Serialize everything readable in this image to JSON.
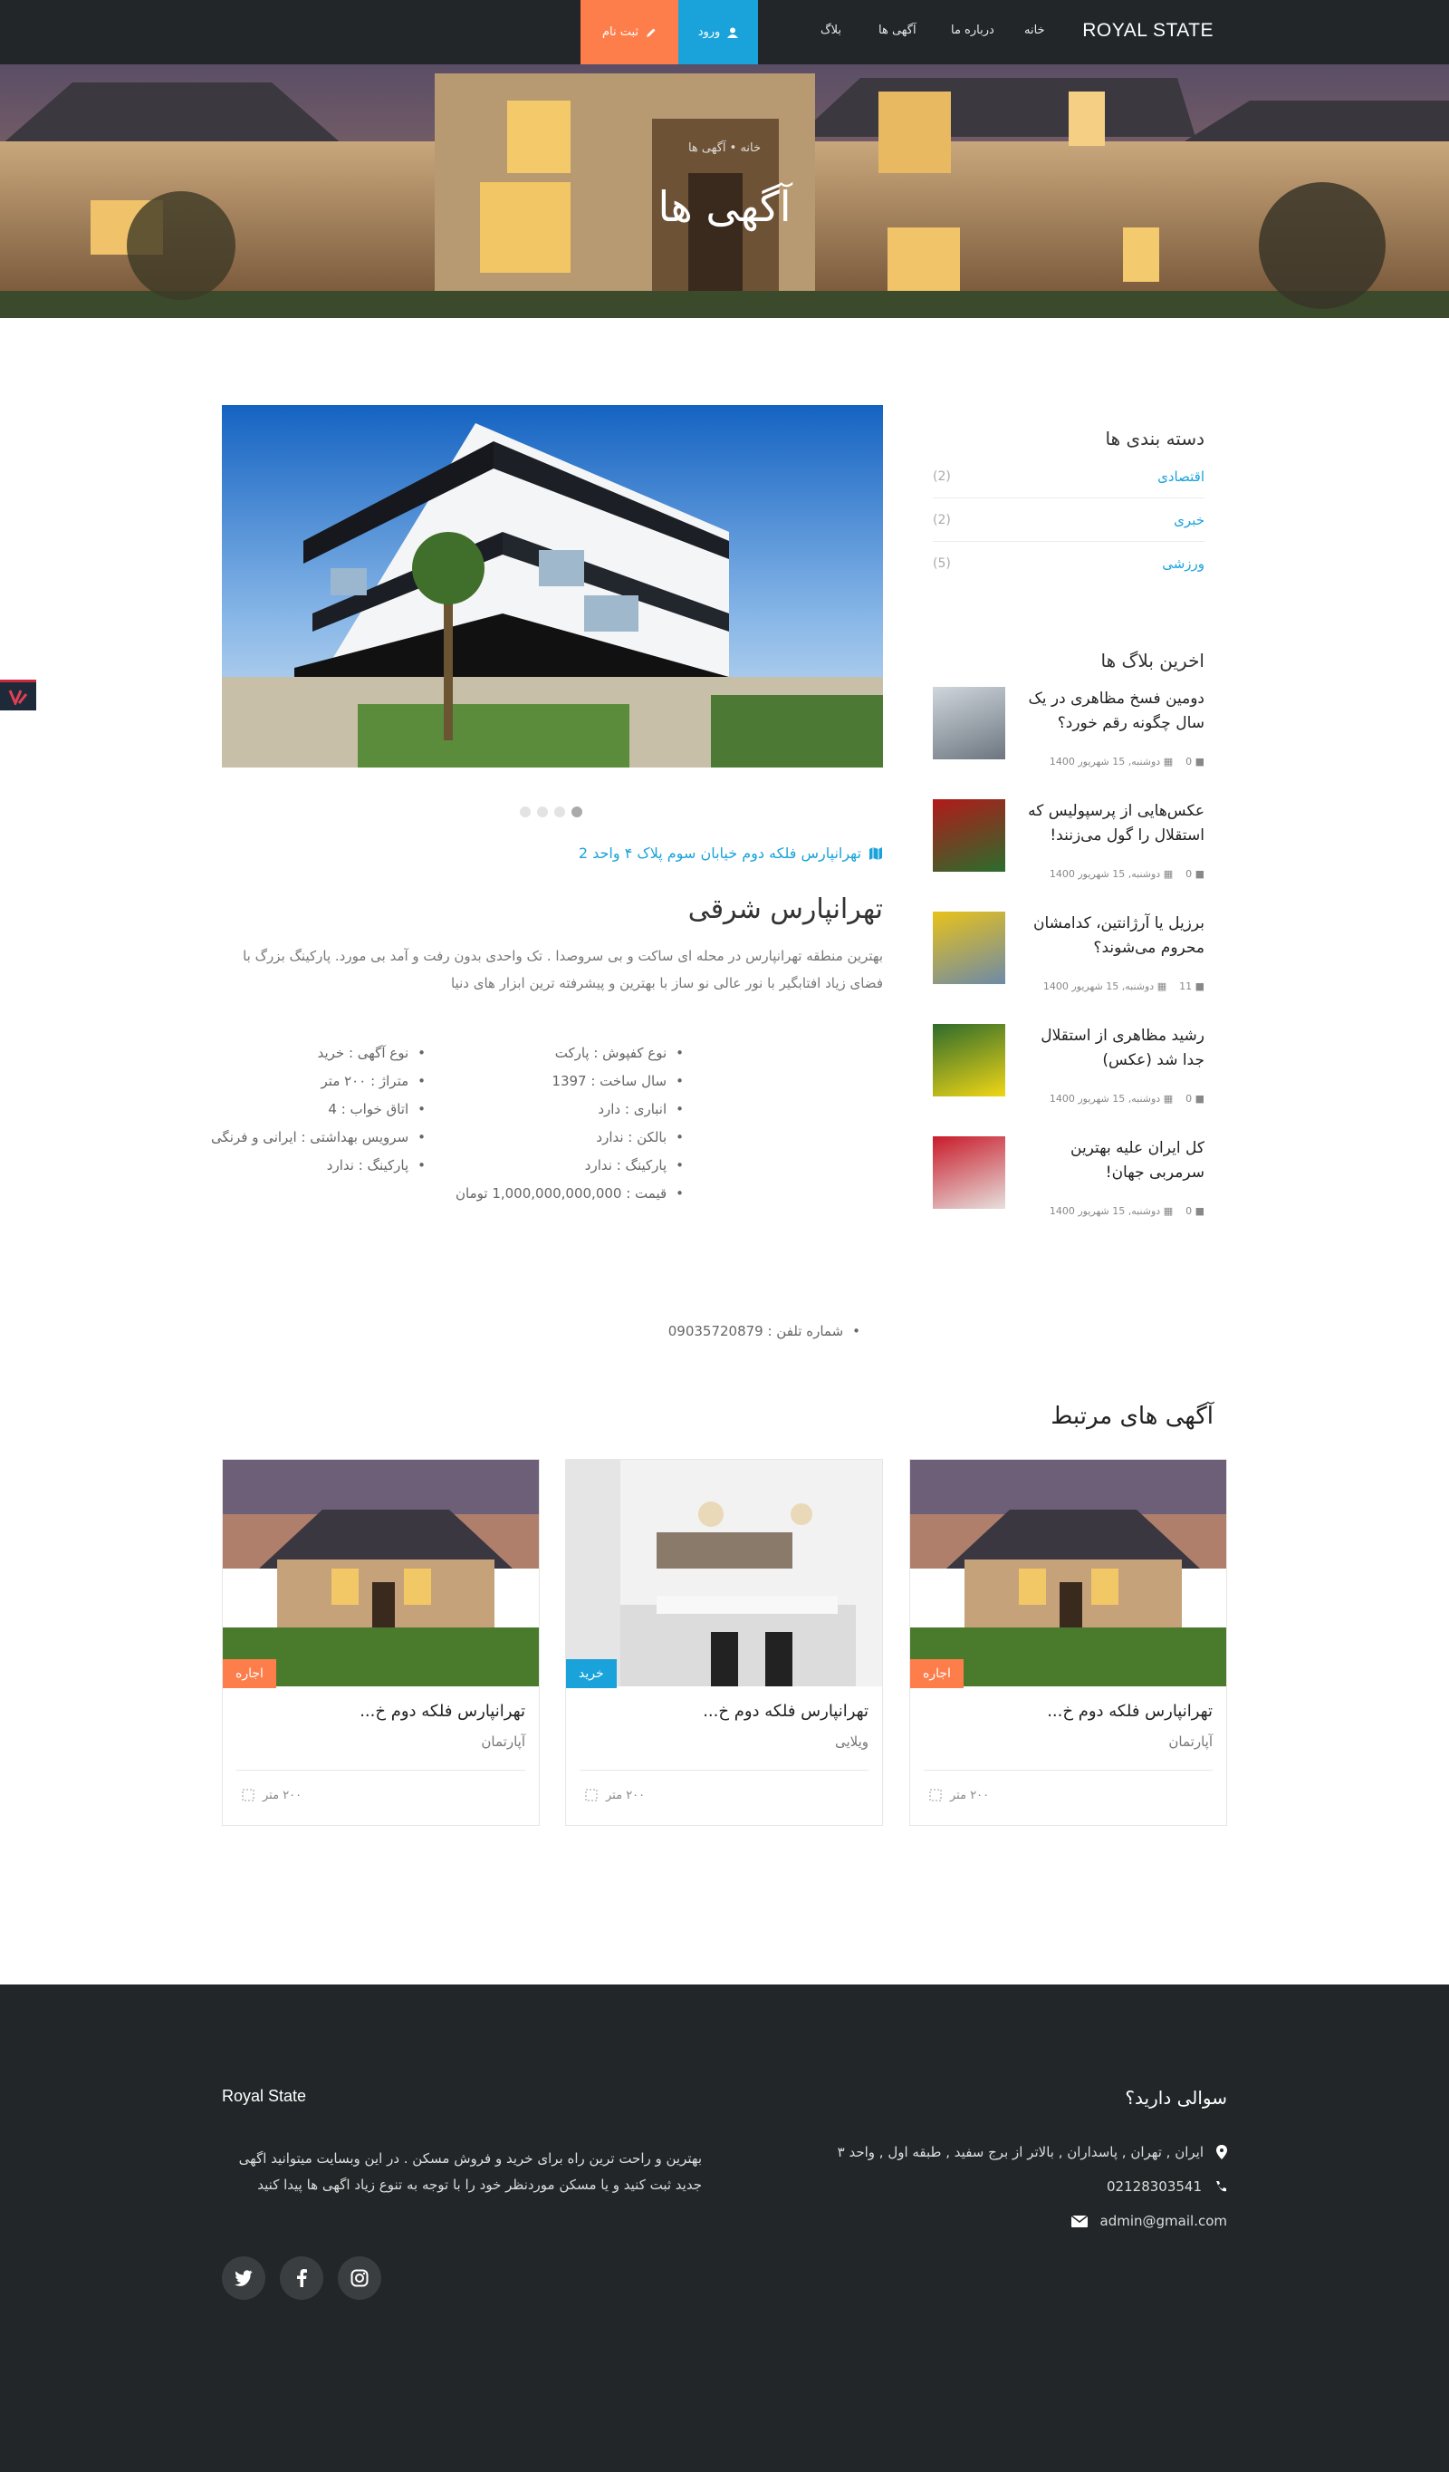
{
  "nav": {
    "brand": "ROYAL STATE",
    "links": [
      "خانه",
      "درباره ما",
      "آگهی ها",
      "بلاگ"
    ],
    "login_label": "ورود",
    "register_label": "ثبت نام"
  },
  "hero": {
    "breadcrumb": "خانه • آگهی ها",
    "title": "آگهی ها"
  },
  "property": {
    "address": "تهرانپارس فلکه دوم خیابان سوم پلاک ۴ واحد 2",
    "title": "تهرانپارس شرقی",
    "description": "بهترین منطقه تهرانپارس در محله ای ساکت و بی سروصدا . تک واحدی بدون رفت و آمد بی مورد. پارکینگ بزرگ با فضای زیاد افتابگیر با نور عالی نو ساز با بهترین و پیشرفته ترین ابزار های دنیا",
    "features_right": [
      "نوع کفپوش : پارکت",
      "سال ساخت : 1397",
      "انباری : دارد",
      "بالکن : ندارد",
      "پارکینگ : ندارد",
      "قیمت : 1,000,000,000,000 تومان"
    ],
    "features_left": [
      "نوع آگهی : خرید",
      "متراژ : ۲۰۰ متر",
      "اتاق خواب : 4",
      "سرویس بهداشتی : ایرانی و فرنگی",
      "پارکینگ : ندارد"
    ],
    "phone": "شماره تلفن : 09035720879"
  },
  "sidebar": {
    "categories_title": "دسته بندی ها",
    "categories": [
      {
        "name": "اقتصادی",
        "count": "(2)"
      },
      {
        "name": "خبری",
        "count": "(2)"
      },
      {
        "name": "ورزشی",
        "count": "(5)"
      }
    ],
    "posts_title": "اخرین بلاگ ها",
    "posts": [
      {
        "title": "دومین فسخ مظاهری در یک سال چگونه رقم خورد؟",
        "date": "دوشنبه, 15 شهریور 1400",
        "comments": "0"
      },
      {
        "title": "عکس‌هایی از پرسپولیس که استقلال را گول می‌زنند!",
        "date": "دوشنبه, 15 شهریور 1400",
        "comments": "0"
      },
      {
        "title": "برزیل یا آرژانتین، کدامشان محروم می‌شوند؟",
        "date": "دوشنبه, 15 شهریور 1400",
        "comments": "11"
      },
      {
        "title": "رشید مظاهری از استقلال جدا شد (عکس)",
        "date": "دوشنبه, 15 شهریور 1400",
        "comments": "0"
      },
      {
        "title": "کل ایران علیه بهترین سرمربی جهان!",
        "date": "دوشنبه, 15 شهریور 1400",
        "comments": "0"
      }
    ]
  },
  "related": {
    "title": "آگهی های مرتبط",
    "cards": [
      {
        "badge": "اجاره",
        "title": "تهرانپارس فلکه دوم خ...",
        "type": "آپارتمان",
        "area": "۲۰۰ متر",
        "badge_color": "#fd7e4b"
      },
      {
        "badge": "خرید",
        "title": "تهرانپارس فلکه دوم خ...",
        "type": "ویلایی",
        "area": "۲۰۰ متر",
        "badge_color": "#1aa3db"
      },
      {
        "badge": "اجاره",
        "title": "تهرانپارس فلکه دوم خ...",
        "type": "آپارتمان",
        "area": "۲۰۰ متر",
        "badge_color": "#fd7e4b"
      }
    ]
  },
  "footer": {
    "question": "سوالی دارید؟",
    "address": "ایران , تهران , پاسداران , بالاتر از برج سفید , طبقه اول , واحد ۳",
    "phone": "02128303541",
    "email": "admin@gmail.com",
    "brand": "Royal State",
    "about": "بهترین و راحت ترین راه برای خرید و فروش مسکن . در این وبسایت میتوانید اگهی جدید ثبت کنید و یا مسکن موردنظر خود را با توجه به تنوع زیاد اگهی ها پیدا کنید"
  },
  "colors": {
    "accent_blue": "#1aa3db",
    "accent_orange": "#fd7e4b",
    "dark": "#222628"
  },
  "slider": {
    "slides": 4,
    "active_slide": 1
  }
}
